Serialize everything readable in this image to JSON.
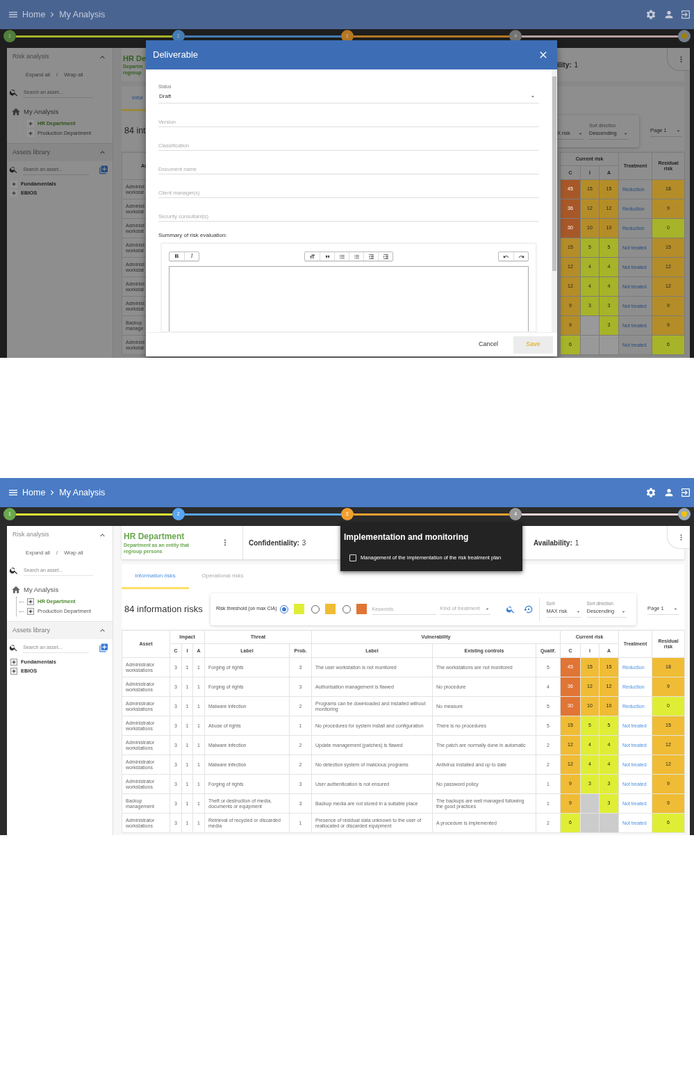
{
  "screens": [
    {
      "header": {
        "breadcrumb": [
          "Home",
          "My Analysis"
        ]
      },
      "stepper": {
        "steps": [
          {
            "kind": "number",
            "label": "1",
            "color": "#507e3b"
          },
          {
            "kind": "number",
            "label": "2",
            "color": "#447cb4"
          },
          {
            "kind": "number",
            "label": "3",
            "color": "#b47824"
          },
          {
            "kind": "number",
            "label": "4",
            "color": "#747474"
          },
          {
            "kind": "badge",
            "color": "#747e8a"
          }
        ],
        "connectors": [
          {
            "color": "#a7b328"
          },
          {
            "color": "#447cb4"
          },
          {
            "color": "#b47824"
          },
          {
            "color": "#b7a1a1"
          }
        ]
      },
      "sidebar": {
        "sections": [
          {
            "title": "Risk analysis",
            "expanded": true,
            "highlighted": false,
            "expand_link": "Expand all",
            "separator": "/",
            "wrap_link": "Wrap all",
            "search": {
              "placeholder": "Search an asset..."
            },
            "tree": [
              {
                "kind": "root",
                "label": "My Analysis",
                "selected": false,
                "children": [
                  {
                    "kind": "node",
                    "label": "HR Department",
                    "selected": true,
                    "expanded": false
                  },
                  {
                    "kind": "node",
                    "label": "Production Department",
                    "selected": false,
                    "expanded": false
                  }
                ]
              }
            ]
          },
          {
            "title": "Assets library",
            "expanded": true,
            "highlighted": true,
            "search": {
              "placeholder": "Search an asset..."
            },
            "add_button": true,
            "tree": [
              {
                "kind": "category",
                "label": "Fundamentals",
                "selected": false,
                "expanded": false
              },
              {
                "kind": "category",
                "label": "EBIOS",
                "selected": false,
                "expanded": false
              }
            ]
          }
        ]
      },
      "background_left": {
        "asset_title": "HR De",
        "asset_description": "Departm regroup",
        "tab": {
          "label": "Infor",
          "selected": true
        },
        "count": "84 int",
        "asset_header": "As",
        "rows": [
          {
            "asset": "Administ workstat"
          },
          {
            "asset": "Administ workstat"
          },
          {
            "asset": "Administ workstat"
          },
          {
            "asset": "Administ workstat"
          },
          {
            "asset": "Administ workstat"
          },
          {
            "asset": "Administ workstat"
          },
          {
            "asset": "Administ workstat"
          },
          {
            "asset": "Backup manage"
          },
          {
            "asset": "Administ workstat"
          }
        ]
      },
      "background_right": {
        "metric": {
          "label": "ility:",
          "value": "1"
        },
        "sort": {
          "value": "X risk"
        },
        "sort_direction": {
          "label": "Sort direction",
          "value": "Descending"
        },
        "page": {
          "value": "Page 1"
        },
        "table": {
          "header": {
            "current_risk": "Current risk",
            "current_risk_sub": [
              "C",
              "I",
              "A"
            ],
            "treatment": "Treatment",
            "residual_risk": "Residual risk"
          },
          "rows": [
            {
              "current_risk": [
                {
                  "value": "45",
                  "color": "#a85828"
                },
                {
                  "value": "15",
                  "color": "#b48d28"
                },
                {
                  "value": "15",
                  "color": "#b48d28"
                }
              ],
              "treatment": "Reduction",
              "residual_risk": {
                "value": "18",
                "color": "#b48d28"
              }
            },
            {
              "current_risk": [
                {
                  "value": "36",
                  "color": "#a85828"
                },
                {
                  "value": "12",
                  "color": "#b48d28"
                },
                {
                  "value": "12",
                  "color": "#b48d28"
                }
              ],
              "treatment": "Reduction",
              "residual_risk": {
                "value": "9",
                "color": "#b48d28"
              }
            },
            {
              "current_risk": [
                {
                  "value": "30",
                  "color": "#a85828"
                },
                {
                  "value": "10",
                  "color": "#b48d28"
                },
                {
                  "value": "10",
                  "color": "#b48d28"
                }
              ],
              "treatment": "Reduction",
              "residual_risk": {
                "value": "0",
                "color": "#a7b328"
              }
            },
            {
              "current_risk": [
                {
                  "value": "15",
                  "color": "#b48d28"
                },
                {
                  "value": "5",
                  "color": "#a7b328"
                },
                {
                  "value": "5",
                  "color": "#a7b328"
                }
              ],
              "treatment": "Not treated",
              "residual_risk": {
                "value": "15",
                "color": "#b48d28"
              }
            },
            {
              "current_risk": [
                {
                  "value": "12",
                  "color": "#b48d28"
                },
                {
                  "value": "4",
                  "color": "#a7b328"
                },
                {
                  "value": "4",
                  "color": "#a7b328"
                }
              ],
              "treatment": "Not treated",
              "residual_risk": {
                "value": "12",
                "color": "#b48d28"
              }
            },
            {
              "current_risk": [
                {
                  "value": "12",
                  "color": "#b48d28"
                },
                {
                  "value": "4",
                  "color": "#a7b328"
                },
                {
                  "value": "4",
                  "color": "#a7b328"
                }
              ],
              "treatment": "Not treated",
              "residual_risk": {
                "value": "12",
                "color": "#b48d28"
              }
            },
            {
              "current_risk": [
                {
                  "value": "9",
                  "color": "#b48d28"
                },
                {
                  "value": "3",
                  "color": "#a7b328"
                },
                {
                  "value": "3",
                  "color": "#a7b328"
                }
              ],
              "treatment": "Not treated",
              "residual_risk": {
                "value": "9",
                "color": "#b48d28"
              }
            },
            {
              "current_risk": [
                {
                  "value": "9",
                  "color": "#b48d28"
                },
                {
                  "color": "#999999"
                },
                {
                  "value": "3",
                  "color": "#a7b328"
                }
              ],
              "treatment": "Not treated",
              "residual_risk": {
                "value": "9",
                "color": "#b48d28"
              }
            },
            {
              "current_risk": [
                {
                  "value": "6",
                  "color": "#a7b328"
                },
                {
                  "color": "#999999"
                },
                {
                  "color": "#999999"
                }
              ],
              "treatment": "Not treated",
              "residual_risk": {
                "value": "6",
                "color": "#a7b328"
              }
            }
          ]
        }
      },
      "dialog": {
        "title": "Deliverable",
        "fields": [
          {
            "kind": "select",
            "label": "Status",
            "value": "Draft"
          },
          {
            "kind": "text",
            "placeholder": "Version"
          },
          {
            "kind": "text",
            "placeholder": "Classification"
          },
          {
            "kind": "text",
            "placeholder": "Document name"
          },
          {
            "kind": "text",
            "placeholder": "Client manager(s)"
          },
          {
            "kind": "text",
            "placeholder": "Security consultant(s)"
          }
        ],
        "editor": {
          "label": "Summary of risk evaluation:",
          "toolbar": [
            {
              "buttons": [
                {
                  "kind": "bold",
                  "label": "B"
                },
                {
                  "kind": "italic",
                  "label": "I"
                }
              ]
            },
            {
              "buttons": [
                {
                  "kind": "heading"
                },
                {
                  "kind": "quote"
                },
                {
                  "kind": "bullets"
                },
                {
                  "kind": "numbers"
                },
                {
                  "kind": "outdent"
                },
                {
                  "kind": "indent"
                }
              ]
            },
            {
              "buttons": [
                {
                  "kind": "undo"
                },
                {
                  "kind": "redo"
                }
              ]
            }
          ]
        },
        "actions": [
          {
            "kind": "flat",
            "label": "Cancel",
            "disabled": false
          },
          {
            "kind": "raised",
            "label": "Save",
            "disabled": true
          }
        ]
      }
    },
    {
      "header": {
        "breadcrumb": [
          "Home",
          "My Analysis"
        ]
      },
      "stepper": {
        "steps": [
          {
            "kind": "number",
            "label": "1",
            "color": "#6aa84f"
          },
          {
            "kind": "number",
            "label": "2",
            "color": "#5aa5f0"
          },
          {
            "kind": "number",
            "label": "3",
            "color": "#f0a030"
          },
          {
            "kind": "number",
            "label": "4",
            "color": "#9a9a9a"
          },
          {
            "kind": "badge",
            "color": "#9aa8b8"
          }
        ],
        "connectors": [
          {
            "color": "#dfee35"
          },
          {
            "color": "#5aa5f0"
          },
          {
            "color": "#f0a030"
          },
          {
            "color": "#f4d6d6"
          }
        ]
      },
      "sidebar": {
        "sections": [
          {
            "title": "Risk analysis",
            "expanded": true,
            "highlighted": false,
            "expand_link": "Expand all",
            "separator": "/",
            "wrap_link": "Wrap all",
            "search": {
              "placeholder": "Search an asset..."
            },
            "tree": [
              {
                "kind": "root",
                "label": "My Analysis",
                "selected": false,
                "children": [
                  {
                    "kind": "node",
                    "label": "HR Department",
                    "selected": true,
                    "expanded": false
                  },
                  {
                    "kind": "node",
                    "label": "Production Department",
                    "selected": false,
                    "expanded": false
                  }
                ]
              }
            ]
          },
          {
            "title": "Assets library",
            "expanded": true,
            "highlighted": true,
            "search": {
              "placeholder": "Search an asset..."
            },
            "add_button": true,
            "tree": [
              {
                "kind": "category",
                "label": "Fundamentals",
                "selected": false,
                "expanded": false
              },
              {
                "kind": "category",
                "label": "EBIOS",
                "selected": false,
                "expanded": false
              }
            ]
          }
        ]
      },
      "main": {
        "asset_card": {
          "title": "HR Department",
          "description": "Department as an entity that regroup persons",
          "metrics": [
            {
              "label": "Confidentiality:",
              "value": "3"
            },
            {
              "label": "Availability:",
              "value": "1"
            }
          ]
        },
        "tabs": [
          {
            "label": "Information risks",
            "selected": true
          },
          {
            "label": "Operational risks",
            "selected": false
          }
        ],
        "toolbar": {
          "count": "84 information risks",
          "threshold": {
            "label": "Risk threshold (on max CIA)",
            "options": [
              {
                "selected": true,
                "color": "#dfee35"
              },
              {
                "selected": false,
                "color": "#f0bc35"
              },
              {
                "selected": false,
                "color": "#e07535"
              }
            ]
          },
          "keywords": {
            "placeholder": "Keywords"
          },
          "treatment_filter": {
            "placeholder": "Kind of treatment"
          },
          "sort": {
            "label": "Sort",
            "value": "MAX risk"
          },
          "sort_direction": {
            "label": "Sort direction",
            "value": "Descending"
          },
          "page": {
            "value": "Page 1"
          }
        },
        "table": {
          "header": {
            "asset": "Asset",
            "impact": "Impact",
            "impact_sub": [
              "C",
              "I",
              "A"
            ],
            "threat": "Threat",
            "threat_sub": [
              "Label",
              "Prob."
            ],
            "vulnerability": "Vulnerability",
            "vulnerability_sub": [
              "Label",
              "Existing controls",
              "Qualif."
            ],
            "current_risk": "Current risk",
            "current_risk_sub": [
              "C",
              "I",
              "A"
            ],
            "treatment": "Treatment",
            "residual_risk": "Residual risk"
          },
          "rows": [
            {
              "asset": "Administrator workstations",
              "impact": [
                "3",
                "1",
                "1"
              ],
              "threat": "Forging of rights",
              "probability": "3",
              "vulnerability": "The user workstation is not monitored",
              "existing_controls": "The workstations are not monitored",
              "qualification": "5",
              "current_risk": [
                {
                  "value": "45",
                  "color": "#e07535"
                },
                {
                  "value": "15",
                  "color": "#f0bc35"
                },
                {
                  "value": "15",
                  "color": "#f0bc35"
                }
              ],
              "treatment": "Reduction",
              "residual_risk": {
                "value": "18",
                "color": "#f0bc35"
              }
            },
            {
              "asset": "Administrator workstations",
              "impact": [
                "3",
                "1",
                "1"
              ],
              "threat": "Forging of rights",
              "probability": "3",
              "vulnerability": "Authorisation management is flawed",
              "existing_controls": "No procedure",
              "qualification": "4",
              "current_risk": [
                {
                  "value": "36",
                  "color": "#e07535"
                },
                {
                  "value": "12",
                  "color": "#f0bc35"
                },
                {
                  "value": "12",
                  "color": "#f0bc35"
                }
              ],
              "treatment": "Reduction",
              "residual_risk": {
                "value": "9",
                "color": "#f0bc35"
              }
            },
            {
              "asset": "Administrator workstations",
              "impact": [
                "3",
                "1",
                "1"
              ],
              "threat": "Malware infection",
              "probability": "2",
              "vulnerability": "Programs can be downloaded and installed without monitoring",
              "existing_controls": "No measure",
              "qualification": "5",
              "current_risk": [
                {
                  "value": "30",
                  "color": "#e07535"
                },
                {
                  "value": "10",
                  "color": "#f0bc35"
                },
                {
                  "value": "10",
                  "color": "#f0bc35"
                }
              ],
              "treatment": "Reduction",
              "residual_risk": {
                "value": "0",
                "color": "#dfee35"
              }
            },
            {
              "asset": "Administrator workstations",
              "impact": [
                "3",
                "1",
                "1"
              ],
              "threat": "Abuse of rights",
              "probability": "1",
              "vulnerability": "No procedures for system install and configuration",
              "existing_controls": "There is no procedures",
              "qualification": "5",
              "current_risk": [
                {
                  "value": "15",
                  "color": "#f0bc35"
                },
                {
                  "value": "5",
                  "color": "#dfee35"
                },
                {
                  "value": "5",
                  "color": "#dfee35"
                }
              ],
              "treatment": "Not treated",
              "residual_risk": {
                "value": "15",
                "color": "#f0bc35"
              }
            },
            {
              "asset": "Administrator workstations",
              "impact": [
                "3",
                "1",
                "1"
              ],
              "threat": "Malware infection",
              "probability": "2",
              "vulnerability": "Update management (patches) is flawed",
              "existing_controls": "The patch are normally done in automatic",
              "qualification": "2",
              "current_risk": [
                {
                  "value": "12",
                  "color": "#f0bc35"
                },
                {
                  "value": "4",
                  "color": "#dfee35"
                },
                {
                  "value": "4",
                  "color": "#dfee35"
                }
              ],
              "treatment": "Not treated",
              "residual_risk": {
                "value": "12",
                "color": "#f0bc35"
              }
            },
            {
              "asset": "Administrator workstations",
              "impact": [
                "3",
                "1",
                "1"
              ],
              "threat": "Malware infection",
              "probability": "2",
              "vulnerability": "No detection system of malicious programs",
              "existing_controls": "Antivirus installed and up to date",
              "qualification": "2",
              "current_risk": [
                {
                  "value": "12",
                  "color": "#f0bc35"
                },
                {
                  "value": "4",
                  "color": "#dfee35"
                },
                {
                  "value": "4",
                  "color": "#dfee35"
                }
              ],
              "treatment": "Not treated",
              "residual_risk": {
                "value": "12",
                "color": "#f0bc35"
              }
            },
            {
              "asset": "Administrator workstations",
              "impact": [
                "3",
                "1",
                "1"
              ],
              "threat": "Forging of rights",
              "probability": "3",
              "vulnerability": "User authentication is not ensured",
              "existing_controls": "No password policy",
              "qualification": "1",
              "current_risk": [
                {
                  "value": "9",
                  "color": "#f0bc35"
                },
                {
                  "value": "3",
                  "color": "#dfee35"
                },
                {
                  "value": "3",
                  "color": "#dfee35"
                }
              ],
              "treatment": "Not treated",
              "residual_risk": {
                "value": "9",
                "color": "#f0bc35"
              }
            },
            {
              "asset": "Backup management",
              "impact": [
                "3",
                "1",
                "1"
              ],
              "threat": "Theft or destruction of media, documents or equipment",
              "probability": "3",
              "vulnerability": "Backup media are not stored in a suitable place",
              "existing_controls": "The backups are well managed following the good practices",
              "qualification": "1",
              "current_risk": [
                {
                  "value": "9",
                  "color": "#f0bc35"
                },
                {
                  "color": "#cccccc"
                },
                {
                  "value": "3",
                  "color": "#dfee35"
                }
              ],
              "treatment": "Not treated",
              "residual_risk": {
                "value": "9",
                "color": "#f0bc35"
              }
            },
            {
              "asset": "Administrator workstations",
              "impact": [
                "3",
                "1",
                "1"
              ],
              "threat": "Retrieval of recycled or discarded media",
              "probability": "1",
              "vulnerability": "Presence of residual data unknown to the user of reallocated or discarded equipment",
              "existing_controls": "A procedure is implemented",
              "qualification": "2",
              "current_risk": [
                {
                  "value": "6",
                  "color": "#dfee35"
                },
                {
                  "color": "#cccccc"
                },
                {
                  "color": "#cccccc"
                }
              ],
              "treatment": "Not treated",
              "residual_risk": {
                "value": "6",
                "color": "#dfee35"
              }
            }
          ]
        }
      },
      "tooltip": {
        "title": "Implementation and monitoring",
        "items": [
          {
            "label": "Management of the implementation of the risk treatment plan",
            "checked": false
          }
        ]
      }
    }
  ]
}
